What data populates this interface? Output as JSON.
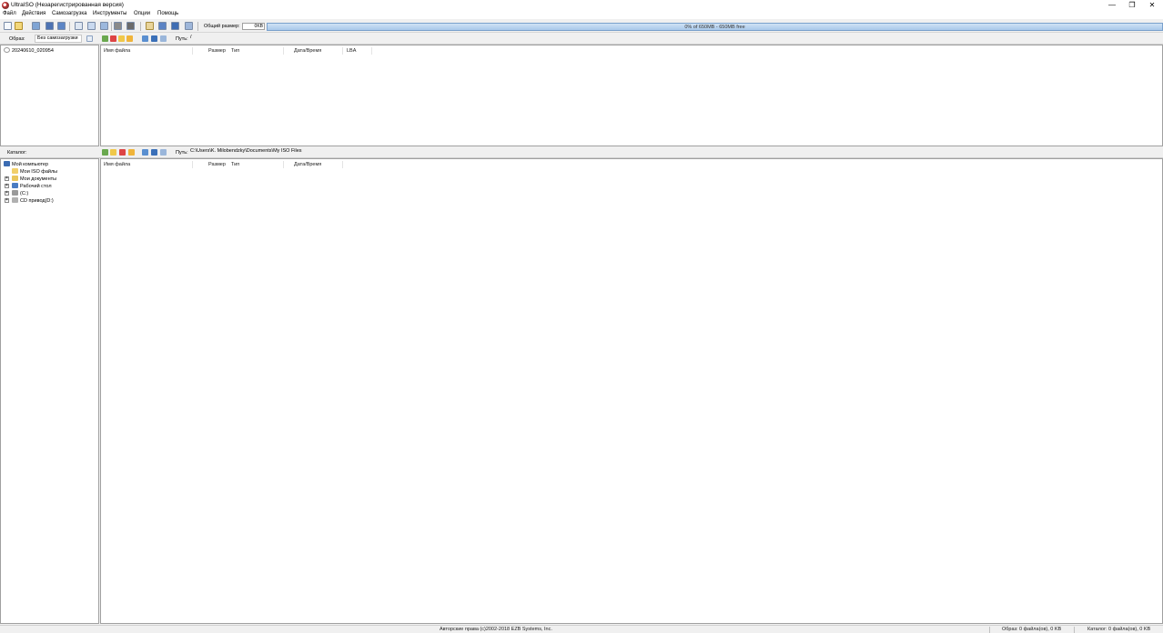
{
  "window": {
    "title": "UltraISO (Незарегистрированная версия)",
    "minimize": "—",
    "restore": "❐",
    "close": "✕"
  },
  "menu": [
    "Файл",
    "Действия",
    "Самозагрузка",
    "Инструменты",
    "Опции",
    "Помощь"
  ],
  "toolbar": {
    "total_size_label": "Общий размер:",
    "total_size_value": "0KB",
    "capacity_text": "0% of 650MB - 650MB free",
    "capacity_fraction": 0.0
  },
  "image_pane": {
    "label": "Образ:",
    "boot_value": "Без самозагрузки",
    "path_label": "Путь:",
    "path_value": "/",
    "tree_root": "20240610_020954",
    "columns": [
      "Имя файла",
      "Размер",
      "Тип",
      "Дата/Время",
      "LBA"
    ]
  },
  "catalog_pane": {
    "label": "Каталог:",
    "path_label": "Путь:",
    "path_value": "C:\\Users\\K. Milobendzky\\Documents\\My ISO Files",
    "columns": [
      "Имя файла",
      "Размер",
      "Тип",
      "Дата/Время"
    ],
    "tree": [
      {
        "label": "Мой компьютер",
        "icon": "computer-icon"
      },
      {
        "label": "Мои ISO файлы",
        "icon": "folder-icon"
      },
      {
        "label": "Мои документы",
        "icon": "documents-icon"
      },
      {
        "label": "Рабочий стол",
        "icon": "desktop-icon"
      },
      {
        "label": "(C:)",
        "icon": "drive-icon"
      },
      {
        "label": "CD привод(D:)",
        "icon": "cd-drive-icon"
      }
    ]
  },
  "status": {
    "copyright": "Авторские права (c)2002-2018 EZB Systems, Inc.",
    "image_info": "Образ: 0 файла(ов), 0 KB",
    "catalog_info": "Каталог: 0 файла(ов), 0 KB"
  }
}
